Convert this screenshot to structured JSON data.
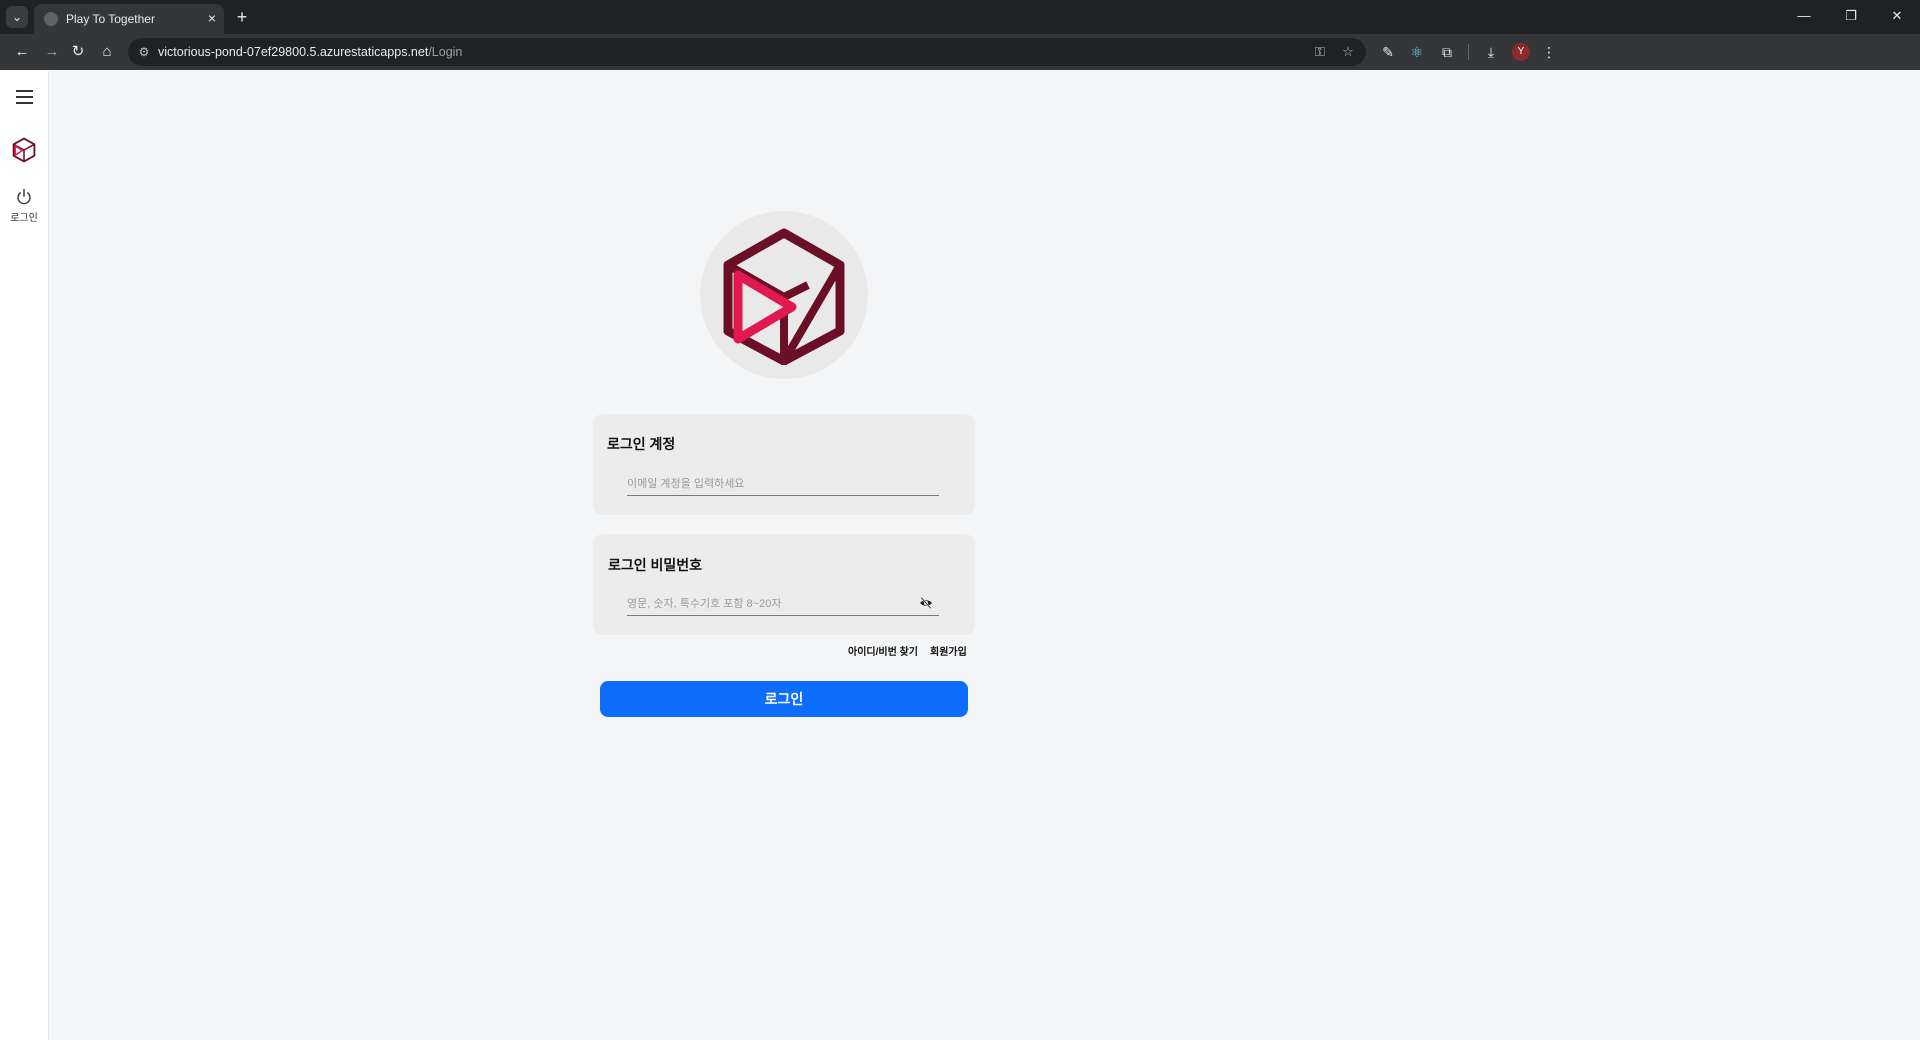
{
  "browser": {
    "tab_list_icon": "chevron-down-icon",
    "tab_title": "Play To Together",
    "tab_close": "×",
    "new_tab": "+",
    "url_host": "victorious-pond-07ef29800.5.azurestaticapps.net",
    "url_path": "/Login",
    "profile_initial": "Y",
    "icons": [
      "back-icon",
      "forward-icon",
      "reload-icon",
      "home-icon",
      "site-info-icon",
      "password-key-icon",
      "bookmark-star-icon",
      "pen-extension-icon",
      "react-devtools-icon",
      "extensions-puzzle-icon",
      "download-icon",
      "menu-kebab-icon"
    ]
  },
  "sidebar": {
    "menu_icon": "hamburger-menu-icon",
    "logo_icon": "app-cube-logo-icon",
    "login_icon": "power-icon",
    "login_label": "로그인"
  },
  "login": {
    "email_label": "로그인 계정",
    "email_placeholder": "이메일 계정을 입력하세요",
    "password_label": "로그인 비밀번호",
    "password_placeholder": "영문, 숫자, 특수기호 포함 8~20자",
    "toggle_icon": "eye-off-icon",
    "find_link": "아이디/비번 찾기",
    "signup_link": "회원가입",
    "submit_label": "로그인"
  },
  "colors": {
    "brand_dark": "#6b0f26",
    "brand_accent": "#e0194f",
    "primary_button": "#0d6efd"
  }
}
